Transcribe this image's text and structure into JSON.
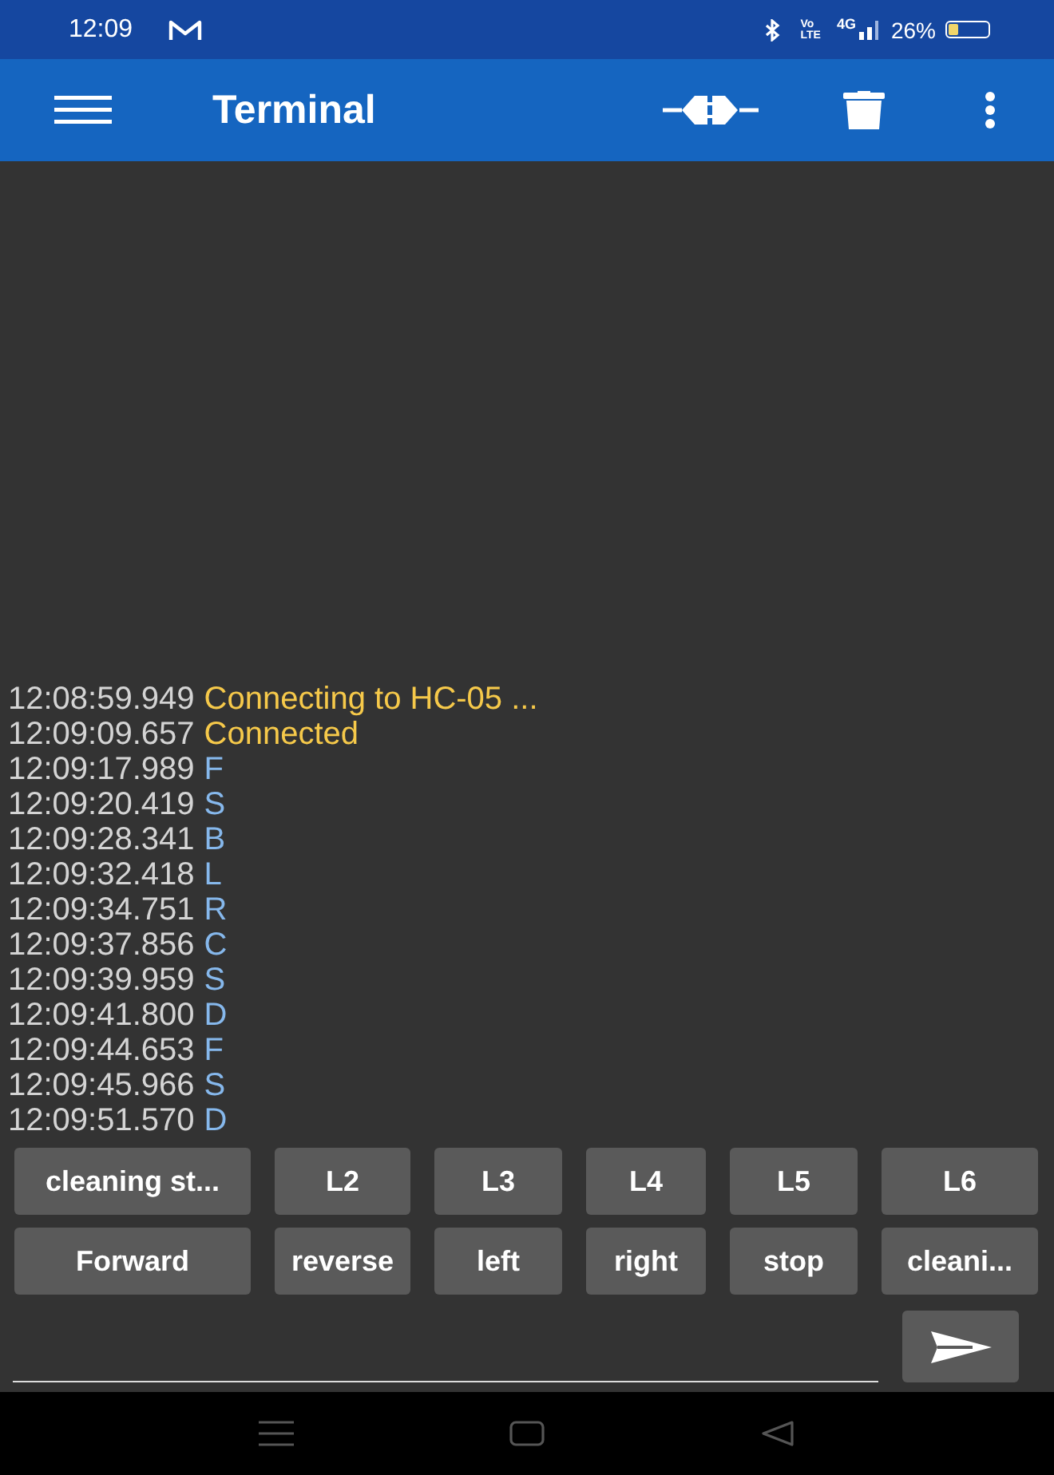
{
  "status_bar": {
    "time": "12:09",
    "volte_top": "Vo",
    "volte_bottom": "LTE",
    "network": "4G",
    "battery_text": "26%",
    "battery": {
      "level": 0.26
    }
  },
  "app_bar": {
    "title": "Terminal"
  },
  "log": [
    {
      "time": "12:08:59.949",
      "text": "Connecting to HC-05 ...",
      "kind": "status"
    },
    {
      "time": "12:09:09.657",
      "text": "Connected",
      "kind": "status"
    },
    {
      "time": "12:09:17.989",
      "text": "F",
      "kind": "sent"
    },
    {
      "time": "12:09:20.419",
      "text": "S",
      "kind": "sent"
    },
    {
      "time": "12:09:28.341",
      "text": "B",
      "kind": "sent"
    },
    {
      "time": "12:09:32.418",
      "text": "L",
      "kind": "sent"
    },
    {
      "time": "12:09:34.751",
      "text": "R",
      "kind": "sent"
    },
    {
      "time": "12:09:37.856",
      "text": "C",
      "kind": "sent"
    },
    {
      "time": "12:09:39.959",
      "text": "S",
      "kind": "sent"
    },
    {
      "time": "12:09:41.800",
      "text": "D",
      "kind": "sent"
    },
    {
      "time": "12:09:44.653",
      "text": "F",
      "kind": "sent"
    },
    {
      "time": "12:09:45.966",
      "text": "S",
      "kind": "sent"
    },
    {
      "time": "12:09:51.570",
      "text": "D",
      "kind": "sent"
    }
  ],
  "macro_buttons": [
    "cleaning st...",
    "L2",
    "L3",
    "L4",
    "L5",
    "L6",
    "Forward",
    "reverse",
    "left",
    "right",
    "stop",
    "cleani..."
  ]
}
